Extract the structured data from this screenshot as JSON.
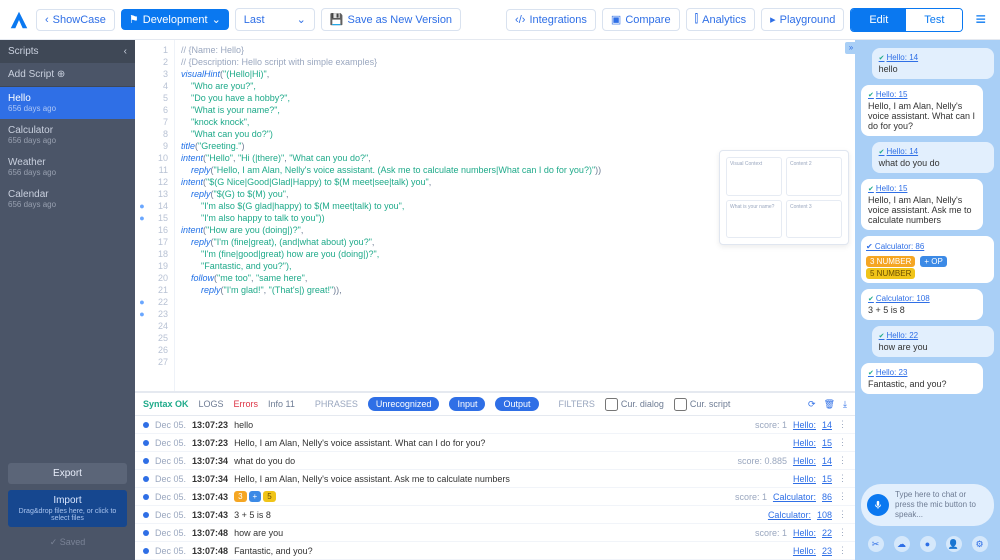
{
  "top": {
    "back_label": "ShowCase",
    "dev_label": "Development",
    "last_label": "Last",
    "save_label": "Save as New Version",
    "integrations": "Integrations",
    "compare": "Compare",
    "analytics": "Analytics",
    "playground": "Playground",
    "edit": "Edit",
    "test": "Test"
  },
  "sidebar": {
    "title": "Scripts",
    "add": "Add Script",
    "items": [
      {
        "name": "Hello",
        "meta": "656 days ago"
      },
      {
        "name": "Calculator",
        "meta": "656 days ago"
      },
      {
        "name": "Weather",
        "meta": "656 days ago"
      },
      {
        "name": "Calendar",
        "meta": "656 days ago"
      }
    ],
    "export": "Export",
    "import": "Import",
    "import_hint": "Drag&drop files here, or click to select files",
    "saved": "✓ Saved"
  },
  "code_lines": [
    {
      "n": 1,
      "c": "com",
      "t": "// {Name: Hello}"
    },
    {
      "n": 2,
      "c": "com",
      "t": "// {Description: Hello script with simple examples}"
    },
    {
      "n": 3,
      "c": "",
      "t": ""
    },
    {
      "n": 4,
      "c": "",
      "t": ""
    },
    {
      "n": 5,
      "c": "mix",
      "t": "visualHint(\"(Hello|Hi)\","
    },
    {
      "n": 6,
      "c": "str",
      "t": "    \"Who are you?\","
    },
    {
      "n": 7,
      "c": "str",
      "t": "    \"Do you have a hobby?\","
    },
    {
      "n": 8,
      "c": "str",
      "t": "    \"What is your name?\","
    },
    {
      "n": 9,
      "c": "str",
      "t": "    \"knock knock\","
    },
    {
      "n": 10,
      "c": "str",
      "t": "    \"What can you do?\")"
    },
    {
      "n": 11,
      "c": "",
      "t": ""
    },
    {
      "n": 12,
      "c": "mix",
      "t": "title(\"Greeting.\")"
    },
    {
      "n": 13,
      "c": "",
      "t": ""
    },
    {
      "n": 14,
      "c": "mix",
      "t": "intent(\"Hello\", \"Hi (|there)\", \"What can you do?\","
    },
    {
      "n": 15,
      "c": "mix",
      "t": "    reply(\"Hello, I am Alan, Nelly's voice assistant. (Ask me to calculate numbers|What can I do for you?)\"))"
    },
    {
      "n": 16,
      "c": "",
      "t": ""
    },
    {
      "n": 17,
      "c": "mix",
      "t": "intent(\"$(G Nice|Good|Glad|Happy) to $(M meet|see|talk) you\","
    },
    {
      "n": 18,
      "c": "mix",
      "t": "    reply(\"$(G) to $(M) you\","
    },
    {
      "n": 19,
      "c": "str",
      "t": "        \"I'm also $(G glad|happy) to $(M meet|talk) to you\","
    },
    {
      "n": 20,
      "c": "str",
      "t": "        \"I'm also happy to talk to you\"))"
    },
    {
      "n": 21,
      "c": "",
      "t": ""
    },
    {
      "n": 22,
      "c": "mix",
      "t": "intent(\"How are you (doing|)?\","
    },
    {
      "n": 23,
      "c": "mix",
      "t": "    reply(\"I'm (fine|great), (and|what about) you?\","
    },
    {
      "n": 24,
      "c": "str",
      "t": "        \"I'm (fine|good|great) how are you (doing|)?\","
    },
    {
      "n": 25,
      "c": "str",
      "t": "        \"Fantastic, and you?\"),"
    },
    {
      "n": 26,
      "c": "mix",
      "t": "    follow(\"me too\", \"same here\","
    },
    {
      "n": 27,
      "c": "mix",
      "t": "        reply(\"I'm glad!\", \"(That's|) great!\")),"
    }
  ],
  "fold_rows": [
    14,
    15,
    22,
    23
  ],
  "status": {
    "syntax": "Syntax OK",
    "tabs": [
      "LOGS",
      "Errors",
      "Info 11"
    ],
    "phrases_lbl": "PHRASES",
    "phrases": [
      "Unrecognized",
      "Input",
      "Output"
    ],
    "filters_lbl": "FILTERS",
    "f1": "Cur. dialog",
    "f2": "Cur. script"
  },
  "logs": [
    {
      "d": "Dec 05.",
      "t": "13:07:23",
      "txt": "hello",
      "score": "score: 1",
      "link": "Hello:",
      "ln": "14"
    },
    {
      "d": "Dec 05.",
      "t": "13:07:23",
      "txt": "Hello, I am Alan, Nelly's voice assistant. What can I do for you?",
      "score": "",
      "link": "Hello:",
      "ln": "15"
    },
    {
      "d": "Dec 05.",
      "t": "13:07:34",
      "txt": "what do you do",
      "score": "score: 0.885",
      "link": "Hello:",
      "ln": "14"
    },
    {
      "d": "Dec 05.",
      "t": "13:07:34",
      "txt": "Hello, I am Alan, Nelly's voice assistant. Ask me to calculate numbers",
      "score": "",
      "link": "Hello:",
      "ln": "15"
    },
    {
      "d": "Dec 05.",
      "t": "13:07:43",
      "txt": "__chips__",
      "score": "score: 1",
      "link": "Calculator:",
      "ln": "86"
    },
    {
      "d": "Dec 05.",
      "t": "13:07:43",
      "txt": "3 + 5 is 8",
      "score": "",
      "link": "Calculator:",
      "ln": "108"
    },
    {
      "d": "Dec 05.",
      "t": "13:07:48",
      "txt": "how are you",
      "score": "score: 1",
      "link": "Hello:",
      "ln": "22"
    },
    {
      "d": "Dec 05.",
      "t": "13:07:48",
      "txt": "Fantastic, and you?",
      "score": "",
      "link": "Hello:",
      "ln": "23"
    }
  ],
  "log_chips": [
    "3",
    "+",
    "5"
  ],
  "chat": [
    {
      "who": "user",
      "lbl": "Hello: 14",
      "txt": "hello"
    },
    {
      "who": "bot",
      "lbl": "Hello: 15",
      "txt": "Hello, I am Alan, Nelly's voice assistant. What can I do for you?"
    },
    {
      "who": "user",
      "lbl": "Hello: 14",
      "txt": "what do you do"
    },
    {
      "who": "bot",
      "lbl": "Hello: 15",
      "txt": "Hello, I am Alan, Nelly's voice assistant. Ask me to calculate numbers"
    },
    {
      "who": "calc",
      "lbl": "Calculator: 86",
      "chips": [
        "3 NUMBER",
        "+ OP",
        "5 NUMBER"
      ]
    },
    {
      "who": "bot",
      "lbl": "Calculator: 108",
      "txt": "3 + 5 is 8"
    },
    {
      "who": "user",
      "lbl": "Hello: 22",
      "txt": "how are you"
    },
    {
      "who": "bot",
      "lbl": "Hello: 23",
      "txt": "Fantastic, and you?"
    }
  ],
  "chat_input": "Type here to chat or press the mic button to speak..."
}
